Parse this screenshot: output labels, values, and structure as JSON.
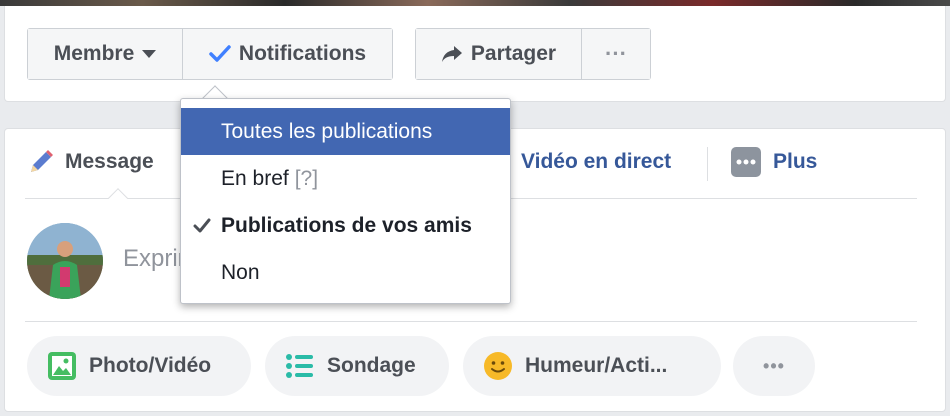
{
  "page_actions": {
    "member_label": "Membre",
    "notifications_label": "Notifications",
    "share_label": "Partager",
    "more_label": "···"
  },
  "notifications_menu": {
    "items": [
      {
        "label": "Toutes les publications",
        "highlighted": true
      },
      {
        "label": "En bref",
        "hint": "[?]"
      },
      {
        "label": "Publications de vos amis",
        "checked": true
      },
      {
        "label": "Non"
      }
    ]
  },
  "composer": {
    "tabs": {
      "message": "Message",
      "live_video": "Vidéo en direct",
      "more": "Plus"
    },
    "placeholder": "Exprimez-vous",
    "actions": [
      {
        "label": "Photo/Vidéo",
        "icon": "photo-icon",
        "color": "#45bd62"
      },
      {
        "label": "Sondage",
        "icon": "list-icon",
        "color": "#2abba7"
      },
      {
        "label": "Humeur/Acti...",
        "icon": "smiley-icon",
        "color": "#f7b928"
      },
      {
        "label": "•••"
      }
    ]
  },
  "colors": {
    "accent_blue": "#4267b2",
    "link_blue": "#365899",
    "check_blue": "#4080ff"
  }
}
